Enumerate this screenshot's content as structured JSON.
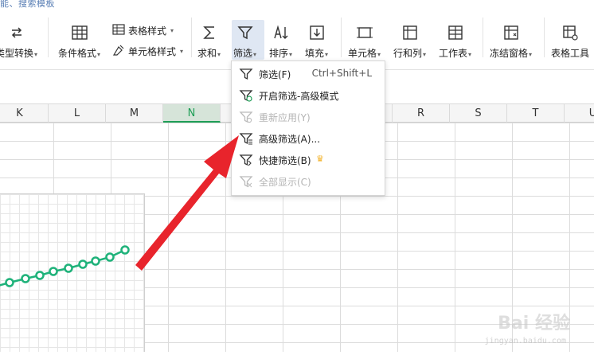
{
  "ribbon": {
    "title_fragment": "能、搜索模板",
    "type_convert": "类型转换",
    "conditional_format": "条件格式",
    "table_style": "表格样式",
    "cell_style": "单元格样式",
    "sum": "求和",
    "filter": "筛选",
    "sort": "排序",
    "fill": "填充",
    "cell": "单元格",
    "row_col": "行和列",
    "worksheet": "工作表",
    "freeze": "冻结窗格",
    "table_tools": "表格工具"
  },
  "columns": [
    "K",
    "L",
    "M",
    "N",
    "O",
    "P",
    "Q",
    "R",
    "S",
    "T",
    "U"
  ],
  "selected_column": "N",
  "menu": {
    "items": [
      {
        "label": "筛选(F)",
        "shortcut": "Ctrl+Shift+L",
        "disabled": false,
        "icon": "filter-icon"
      },
      {
        "label": "开启筛选-高级模式",
        "shortcut": "",
        "disabled": false,
        "icon": "filter-advanced-mode-icon"
      },
      {
        "label": "重新应用(Y)",
        "shortcut": "",
        "disabled": true,
        "icon": "filter-reapply-icon"
      },
      {
        "label": "高级筛选(A)...",
        "shortcut": "",
        "disabled": false,
        "icon": "advanced-filter-icon"
      },
      {
        "label": "快捷筛选(B)",
        "shortcut": "",
        "disabled": false,
        "icon": "quick-filter-icon",
        "badge": "crown-icon"
      },
      {
        "label": "全部显示(C)",
        "shortcut": "",
        "disabled": true,
        "icon": "show-all-icon"
      }
    ]
  },
  "colors": {
    "accent_green": "#1e9e56",
    "arrow_red": "#e8242c",
    "series_green": "#1fb27a",
    "crown_gold": "#f2b127"
  },
  "watermark": {
    "text": "Bai 经验",
    "url": "jingyan.baidu.com"
  }
}
